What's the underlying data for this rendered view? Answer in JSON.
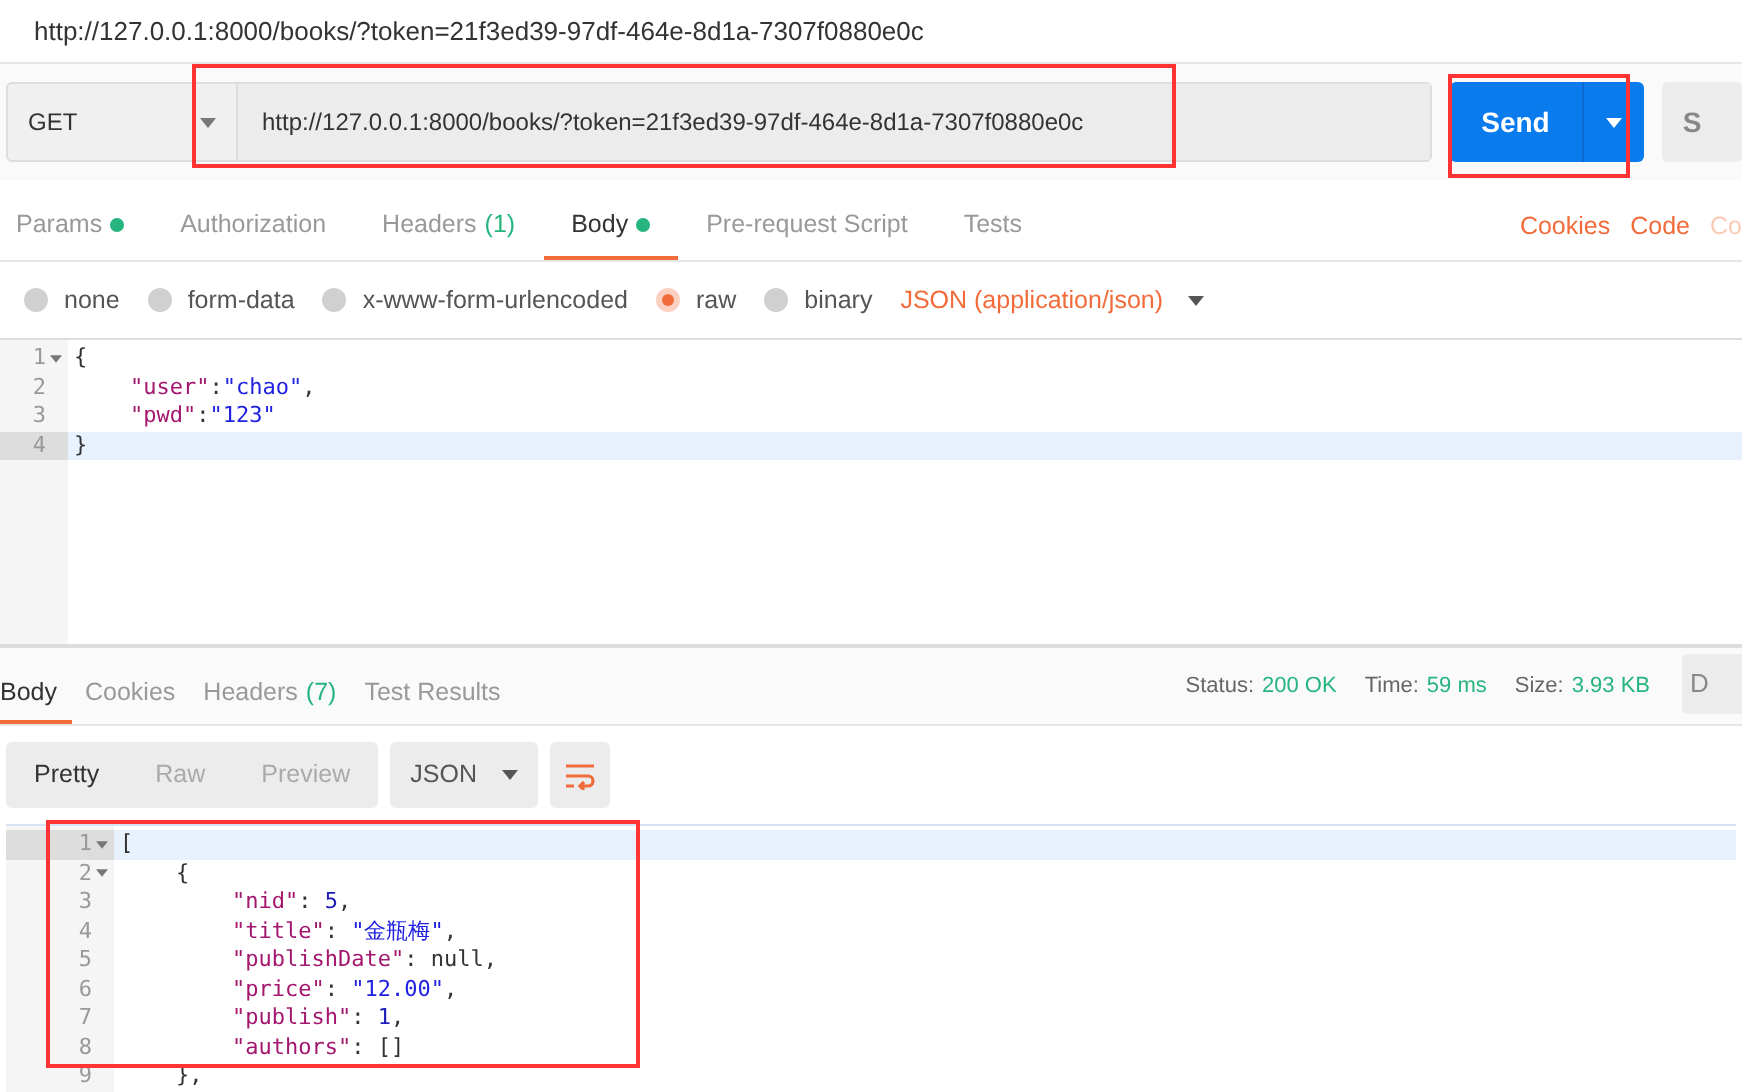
{
  "window": {
    "title": "http://127.0.0.1:8000/books/?token=21f3ed39-97df-464e-8d1a-7307f0880e0c"
  },
  "request": {
    "method": "GET",
    "url": "http://127.0.0.1:8000/books/?token=21f3ed39-97df-464e-8d1a-7307f0880e0c",
    "send": "Send",
    "save": "S"
  },
  "request_tabs": [
    {
      "label": "Params",
      "dot": true,
      "selected": false
    },
    {
      "label": "Authorization",
      "dot": false,
      "selected": false
    },
    {
      "label": "Headers",
      "count": "(1)",
      "dot": false,
      "selected": false
    },
    {
      "label": "Body",
      "dot": true,
      "selected": true
    },
    {
      "label": "Pre-request Script",
      "dot": false,
      "selected": false
    },
    {
      "label": "Tests",
      "dot": false,
      "selected": false
    }
  ],
  "request_links": [
    "Cookies",
    "Code",
    "Co"
  ],
  "body_types": [
    {
      "label": "none",
      "selected": false
    },
    {
      "label": "form-data",
      "selected": false
    },
    {
      "label": "x-www-form-urlencoded",
      "selected": false
    },
    {
      "label": "raw",
      "selected": true
    },
    {
      "label": "binary",
      "selected": false
    }
  ],
  "content_type": "JSON (application/json)",
  "request_body": [
    {
      "number": "1",
      "kind": "top",
      "foldable": true,
      "active": false,
      "tokens": [
        {
          "kind": "punct",
          "text": "{"
        }
      ]
    },
    {
      "number": "2",
      "kind": "nested",
      "foldable": false,
      "active": false,
      "tokens": [
        {
          "kind": "key",
          "text": "\"user\""
        },
        {
          "kind": "punct",
          "text": ":"
        },
        {
          "kind": "string",
          "text": "\"chao\""
        },
        {
          "kind": "punct",
          "text": ","
        }
      ]
    },
    {
      "number": "3",
      "kind": "nested",
      "foldable": false,
      "active": false,
      "tokens": [
        {
          "kind": "key",
          "text": "\"pwd\""
        },
        {
          "kind": "punct",
          "text": ":"
        },
        {
          "kind": "string",
          "text": "\"123\""
        }
      ]
    },
    {
      "number": "4",
      "kind": "top",
      "foldable": false,
      "active": true,
      "tokens": [
        {
          "kind": "punct",
          "text": "}"
        }
      ]
    }
  ],
  "response_tabs": [
    {
      "label": "Body",
      "selected": true
    },
    {
      "label": "Cookies",
      "selected": false
    },
    {
      "label": "Headers",
      "count": "(7)",
      "selected": false
    },
    {
      "label": "Test Results",
      "selected": false
    }
  ],
  "response_stats": [
    {
      "label": "Status:",
      "value": "200 OK"
    },
    {
      "label": "Time:",
      "value": "59 ms"
    },
    {
      "label": "Size:",
      "value": "3.93 KB"
    }
  ],
  "response_side_button": "D",
  "view_modes": [
    {
      "label": "Pretty",
      "selected": true
    },
    {
      "label": "Raw",
      "selected": false
    },
    {
      "label": "Preview",
      "selected": false
    }
  ],
  "format": "JSON",
  "response_body": [
    {
      "number": "1",
      "kind": "top",
      "foldable": true,
      "active": true,
      "tokens": [
        {
          "kind": "punct",
          "text": "["
        }
      ]
    },
    {
      "number": "2",
      "kind": "nested",
      "foldable": true,
      "active": false,
      "tokens": [
        {
          "kind": "punct",
          "text": "{"
        }
      ]
    },
    {
      "number": "3",
      "kind": "deep",
      "foldable": false,
      "active": false,
      "tokens": [
        {
          "kind": "key",
          "text": "\"nid\""
        },
        {
          "kind": "punct",
          "text": ": "
        },
        {
          "kind": "number",
          "text": "5"
        },
        {
          "kind": "punct",
          "text": ","
        }
      ]
    },
    {
      "number": "4",
      "kind": "deep",
      "foldable": false,
      "active": false,
      "tokens": [
        {
          "kind": "key",
          "text": "\"title\""
        },
        {
          "kind": "punct",
          "text": ": "
        },
        {
          "kind": "string",
          "text": "\"金瓶梅\""
        },
        {
          "kind": "punct",
          "text": ","
        }
      ]
    },
    {
      "number": "5",
      "kind": "deep",
      "foldable": false,
      "active": false,
      "tokens": [
        {
          "kind": "key",
          "text": "\"publishDate\""
        },
        {
          "kind": "punct",
          "text": ": null,"
        }
      ]
    },
    {
      "number": "6",
      "kind": "deep",
      "foldable": false,
      "active": false,
      "tokens": [
        {
          "kind": "key",
          "text": "\"price\""
        },
        {
          "kind": "punct",
          "text": ": "
        },
        {
          "kind": "string",
          "text": "\"12.00\""
        },
        {
          "kind": "punct",
          "text": ","
        }
      ]
    },
    {
      "number": "7",
      "kind": "deep",
      "foldable": false,
      "active": false,
      "tokens": [
        {
          "kind": "key",
          "text": "\"publish\""
        },
        {
          "kind": "punct",
          "text": ": "
        },
        {
          "kind": "number",
          "text": "1"
        },
        {
          "kind": "punct",
          "text": ","
        }
      ]
    },
    {
      "number": "8",
      "kind": "deep",
      "foldable": false,
      "active": false,
      "tokens": [
        {
          "kind": "key",
          "text": "\"authors\""
        },
        {
          "kind": "punct",
          "text": ": []"
        }
      ]
    },
    {
      "number": "9",
      "kind": "nested",
      "foldable": false,
      "active": false,
      "tokens": [
        {
          "kind": "punct",
          "text": "},"
        }
      ]
    }
  ]
}
